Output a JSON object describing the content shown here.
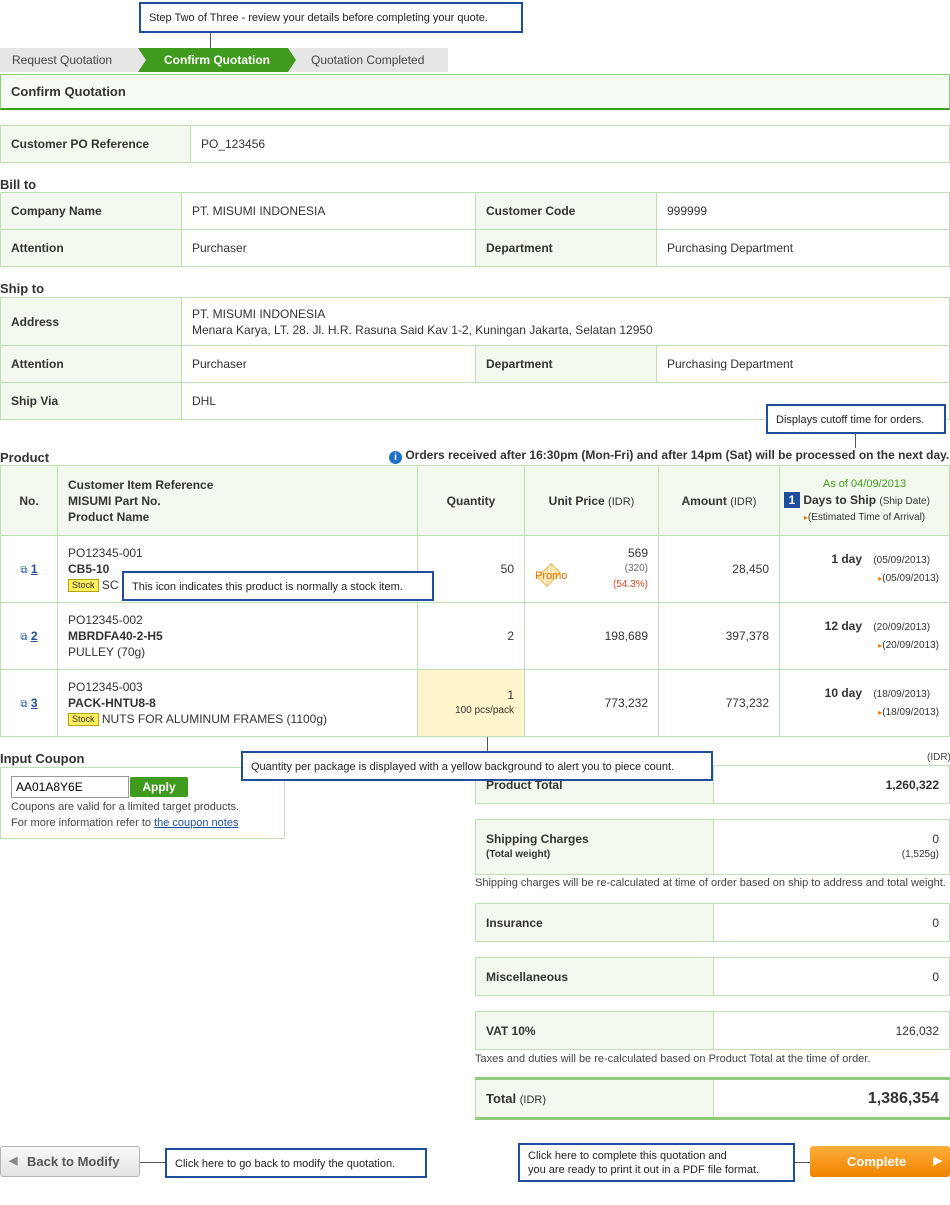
{
  "callouts": {
    "step": "Step Two of Three - review your details before completing your quote.",
    "cutoff": "Displays cutoff time for orders.",
    "stock": "This icon indicates this product is normally a stock item.",
    "quantity": "Quantity per package is displayed with a yellow background to alert you to piece count.",
    "back": "Click here to go back to modify the quotation.",
    "complete_line1": "Click here to complete this quotation and",
    "complete_line2": "you are ready to print it out in a PDF file format."
  },
  "steps": [
    "Request Quotation",
    "Confirm Quotation",
    "Quotation Completed"
  ],
  "page_title": "Confirm Quotation",
  "po": {
    "label": "Customer PO Reference",
    "value": "PO_123456"
  },
  "bill_to": {
    "title": "Bill to",
    "company_label": "Company Name",
    "company": "PT. MISUMI INDONESIA",
    "code_label": "Customer Code",
    "code": "999999",
    "attention_label": "Attention",
    "attention": "Purchaser",
    "dept_label": "Department",
    "dept": "Purchasing Department"
  },
  "ship_to": {
    "title": "Ship to",
    "address_label": "Address",
    "address_line1": "PT. MISUMI INDONESIA",
    "address_line2": "Menara Karya, LT. 28. Jl. H.R. Rasuna Said Kav 1-2, Kuningan Jakarta, Selatan 12950",
    "attention_label": "Attention",
    "attention": "Purchaser",
    "dept_label": "Department",
    "dept": "Purchasing Department",
    "via_label": "Ship Via",
    "via": "DHL"
  },
  "product": {
    "title": "Product",
    "cutoff_notice": "Orders received after 16:30pm (Mon-Fri) and after 14pm (Sat) will be processed on the next day.",
    "headers": {
      "no": "No.",
      "ref1": "Customer Item Reference",
      "ref2": "MISUMI Part No.",
      "ref3": "Product Name",
      "qty": "Quantity",
      "unit_price": "Unit Price",
      "unit_price_cur": "(IDR)",
      "amount": "Amount",
      "amount_cur": "(IDR)",
      "asof": "As of 04/09/2013",
      "marker": "1",
      "dts": "Days to Ship",
      "dts_sub": "(Ship Date)",
      "eta": "(Estimated Time of Arrival)"
    },
    "rows": [
      {
        "no": "1",
        "ref": "PO12345-001",
        "part": "CB5-10",
        "stock": "Stock",
        "name": "SC",
        "qty": "50",
        "qty_pack": "",
        "price": "569",
        "price_orig": "(320)",
        "price_disc": "(54.3%)",
        "promo": "Promo",
        "amount": "28,450",
        "days": "1 day",
        "ship": "(05/09/2013)",
        "eta": "(05/09/2013)"
      },
      {
        "no": "2",
        "ref": "PO12345-002",
        "part": "MBRDFA40-2-H5",
        "stock": "",
        "name": "PULLEY (70g)",
        "qty": "2",
        "qty_pack": "",
        "price": "198,689",
        "price_orig": "",
        "price_disc": "",
        "promo": "",
        "amount": "397,378",
        "days": "12 day",
        "ship": "(20/09/2013)",
        "eta": "(20/09/2013)"
      },
      {
        "no": "3",
        "ref": "PO12345-003",
        "part": "PACK-HNTU8-8",
        "stock": "Stock",
        "name": "NUTS FOR ALUMINUM FRAMES (1100g)",
        "qty": "1",
        "qty_pack": "100 pcs/pack",
        "price": "773,232",
        "price_orig": "",
        "price_disc": "",
        "promo": "",
        "amount": "773,232",
        "days": "10 day",
        "ship": "(18/09/2013)",
        "eta": "(18/09/2013)"
      }
    ]
  },
  "coupon": {
    "title": "Input Coupon",
    "value": "AA01A8Y6E",
    "apply": "Apply",
    "note1": "Coupons are valid for a limited target products.",
    "note2": "For more information refer to",
    "link": "the coupon notes"
  },
  "summary": {
    "currency": "(IDR)",
    "product_total_label": "Product Total",
    "product_total": "1,260,322",
    "shipping_label": "Shipping Charges",
    "shipping_sub": "(Total weight)",
    "shipping": "0",
    "weight": "(1,525g)",
    "shipping_note": "Shipping charges will be re-calculated at time of order based on ship to address and total weight.",
    "insurance_label": "Insurance",
    "insurance": "0",
    "misc_label": "Miscellaneous",
    "misc": "0",
    "vat_label": "VAT 10%",
    "vat": "126,032",
    "tax_note": "Taxes and duties will be re-calculated based on Product Total at the time of order.",
    "total_label": "Total",
    "total_cur": "(IDR)",
    "total": "1,386,354"
  },
  "buttons": {
    "back": "Back to Modify",
    "complete": "Complete"
  }
}
